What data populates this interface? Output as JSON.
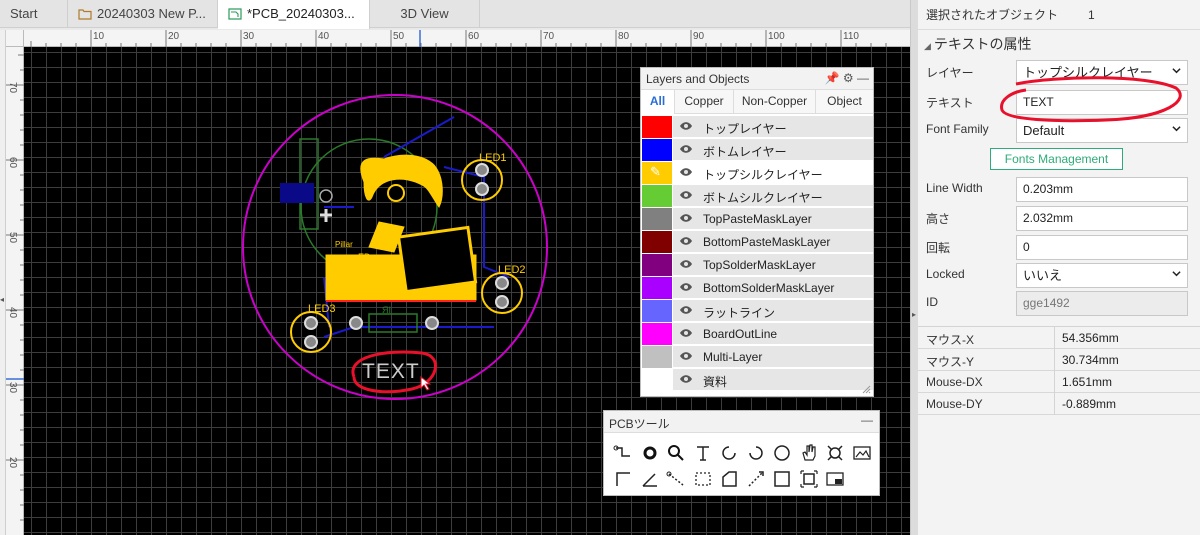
{
  "tabs": [
    {
      "label": "Start",
      "icon": "none"
    },
    {
      "label": "20240303 New P...",
      "icon": "folder-icon"
    },
    {
      "label": "*PCB_20240303...",
      "icon": "pcb-icon"
    },
    {
      "label": "3D View",
      "icon": "none"
    }
  ],
  "rulers": {
    "h_ticks": [
      "10",
      "20",
      "30",
      "40",
      "50",
      "60",
      "70",
      "80",
      "90",
      "100",
      "110"
    ],
    "v_ticks": [
      "70",
      "60",
      "50",
      "40",
      "30",
      "20"
    ]
  },
  "board": {
    "labels": [
      "LED1",
      "LED2",
      "LED3"
    ],
    "silk_text": "TEXT",
    "small_labels": [
      "Pillar",
      "ED",
      "ЯI"
    ],
    "colors": {
      "silk": "#ffcc00",
      "outline": "#cc00cc",
      "bottom": "#0000ff",
      "top": "#ff0000",
      "annotation": "#e8102a"
    }
  },
  "layers_panel": {
    "title": "Layers and Objects",
    "tabs": [
      "All",
      "Copper",
      "Non-Copper",
      "Object"
    ],
    "layers": [
      {
        "name": "トップレイヤー",
        "color": "#ff0000"
      },
      {
        "name": "ボトムレイヤー",
        "color": "#0000ff"
      },
      {
        "name": "トップシルクレイヤー",
        "color": "#ffcc00"
      },
      {
        "name": "ボトムシルクレイヤー",
        "color": "#66cc33"
      },
      {
        "name": "TopPasteMaskLayer",
        "color": "#808080"
      },
      {
        "name": "BottomPasteMaskLayer",
        "color": "#800000"
      },
      {
        "name": "TopSolderMaskLayer",
        "color": "#800080"
      },
      {
        "name": "BottomSolderMaskLayer",
        "color": "#aa00ff"
      },
      {
        "name": "ラットライン",
        "color": "#6666ff"
      },
      {
        "name": "BoardOutLine",
        "color": "#ff00ff"
      },
      {
        "name": "Multi-Layer",
        "color": "#c0c0c0"
      },
      {
        "name": "資料",
        "color": "#ffffff"
      }
    ]
  },
  "pcb_tools": {
    "title": "PCBツール",
    "tools": [
      "wire-icon",
      "pad-icon",
      "via-icon",
      "text-icon",
      "arc-icon",
      "arc-ccw-icon",
      "circle-icon",
      "hand-icon",
      "copper-area-icon",
      "image-icon",
      "line-icon",
      "angle-icon",
      "dimension-icon",
      "rect-select-icon",
      "solid-region-icon",
      "measure-icon",
      "rectangle-icon",
      "crop-icon",
      "board-icon"
    ]
  },
  "properties": {
    "selected_label": "選択されたオブジェクト",
    "selected_count": "1",
    "section_title": "テキストの属性",
    "rows": [
      {
        "label": "レイヤー",
        "value": "トップシルクレイヤー",
        "type": "select"
      },
      {
        "label": "テキスト",
        "value": "TEXT",
        "type": "input"
      },
      {
        "label": "Font Family",
        "value": "Default",
        "type": "select"
      },
      {
        "label": "Line Width",
        "value": "0.203mm",
        "type": "input"
      },
      {
        "label": "高さ",
        "value": "2.032mm",
        "type": "input"
      },
      {
        "label": "回転",
        "value": "0",
        "type": "input"
      },
      {
        "label": "Locked",
        "value": "いいえ",
        "type": "select"
      },
      {
        "label": "ID",
        "value": "gge1492",
        "type": "disabled"
      }
    ],
    "fonts_button": "Fonts Management"
  },
  "mouse": [
    {
      "label": "マウス-X",
      "value": "54.356mm"
    },
    {
      "label": "マウス-Y",
      "value": "30.734mm"
    },
    {
      "label": "Mouse-DX",
      "value": "1.651mm"
    },
    {
      "label": "Mouse-DY",
      "value": "-0.889mm"
    }
  ]
}
